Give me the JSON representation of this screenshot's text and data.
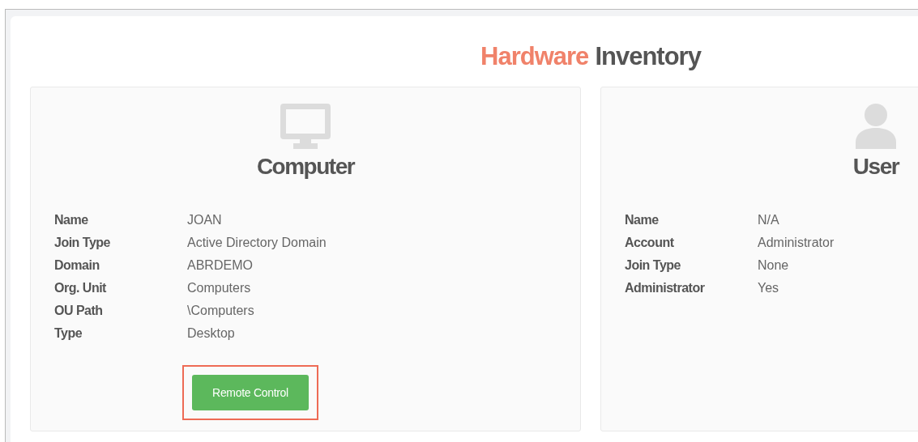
{
  "title": {
    "accent": "Hardware",
    "rest": "Inventory"
  },
  "cards": [
    {
      "kind": "computer",
      "heading": "Computer",
      "fields": [
        {
          "label": "Name",
          "value": "JOAN"
        },
        {
          "label": "Join Type",
          "value": "Active Directory Domain"
        },
        {
          "label": "Domain",
          "value": "ABRDEMO"
        },
        {
          "label": "Org. Unit",
          "value": "Computers"
        },
        {
          "label": "OU Path",
          "value": "\\Computers"
        },
        {
          "label": "Type",
          "value": "Desktop"
        }
      ],
      "button": {
        "label": "Remote Control",
        "highlighted": true
      }
    },
    {
      "kind": "user",
      "heading": "User",
      "fields": [
        {
          "label": "Name",
          "value": "N/A"
        },
        {
          "label": "Account",
          "value": "Administrator"
        },
        {
          "label": "Join Type",
          "value": "None"
        },
        {
          "label": "Administrator",
          "value": "Yes"
        }
      ]
    }
  ]
}
